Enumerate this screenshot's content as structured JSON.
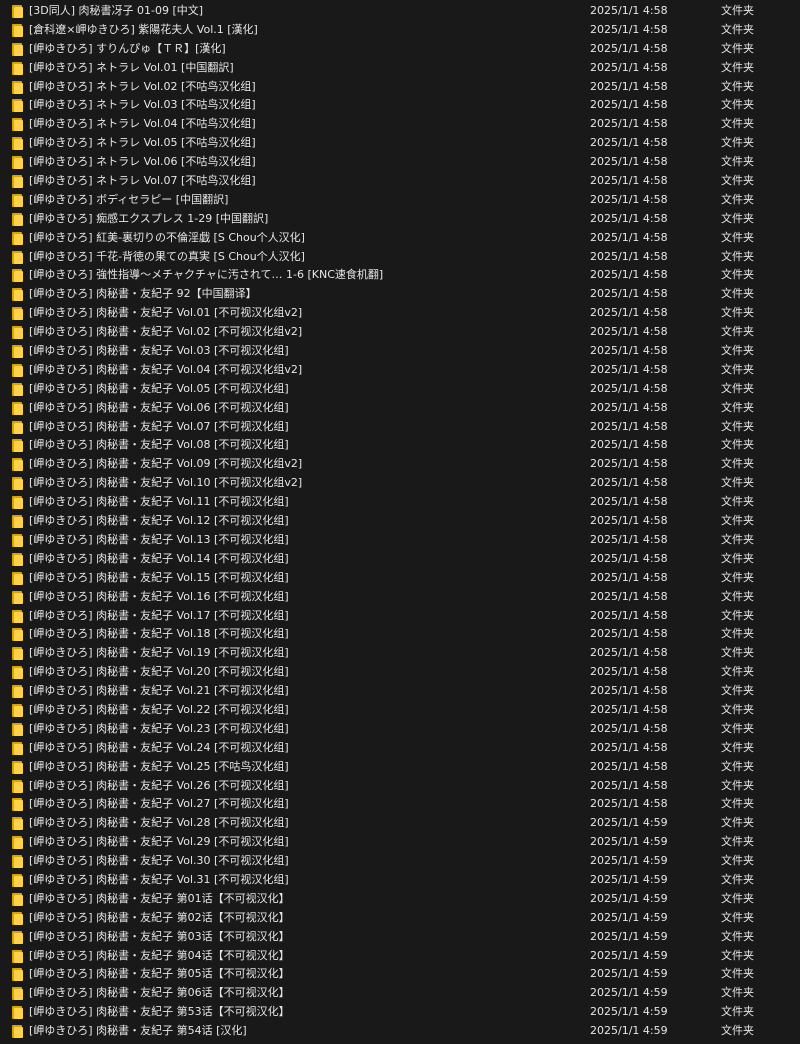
{
  "folder_icon": "folder-icon",
  "rows": [
    {
      "name": "[3D同人] 肉秘書冴子 01-09 [中文]",
      "date": "2025/1/1 4:58",
      "type": "文件夹"
    },
    {
      "name": "[倉科遼×岬ゆきひろ] 紫陽花夫人 Vol.1 [漢化]",
      "date": "2025/1/1 4:58",
      "type": "文件夹"
    },
    {
      "name": "[岬ゆきひろ] すりんぴゅ【ＴＲ】[漢化]",
      "date": "2025/1/1 4:58",
      "type": "文件夹"
    },
    {
      "name": "[岬ゆきひろ] ネトラレ Vol.01 [中国翻訳]",
      "date": "2025/1/1 4:58",
      "type": "文件夹"
    },
    {
      "name": "[岬ゆきひろ] ネトラレ Vol.02 [不咕鸟汉化组]",
      "date": "2025/1/1 4:58",
      "type": "文件夹"
    },
    {
      "name": "[岬ゆきひろ] ネトラレ Vol.03 [不咕鸟汉化组]",
      "date": "2025/1/1 4:58",
      "type": "文件夹"
    },
    {
      "name": "[岬ゆきひろ] ネトラレ Vol.04 [不咕鸟汉化组]",
      "date": "2025/1/1 4:58",
      "type": "文件夹"
    },
    {
      "name": "[岬ゆきひろ] ネトラレ Vol.05 [不咕鸟汉化组]",
      "date": "2025/1/1 4:58",
      "type": "文件夹"
    },
    {
      "name": "[岬ゆきひろ] ネトラレ Vol.06 [不咕鸟汉化组]",
      "date": "2025/1/1 4:58",
      "type": "文件夹"
    },
    {
      "name": "[岬ゆきひろ] ネトラレ Vol.07 [不咕鸟汉化组]",
      "date": "2025/1/1 4:58",
      "type": "文件夹"
    },
    {
      "name": "[岬ゆきひろ] ボディセラピー [中国翻訳]",
      "date": "2025/1/1 4:58",
      "type": "文件夹"
    },
    {
      "name": "[岬ゆきひろ] 痴感エクスプレス 1-29 [中国翻訳]",
      "date": "2025/1/1 4:58",
      "type": "文件夹"
    },
    {
      "name": "[岬ゆきひろ] 紅美-裏切りの不倫淫戯 [S Chou个人汉化]",
      "date": "2025/1/1 4:58",
      "type": "文件夹"
    },
    {
      "name": "[岬ゆきひろ] 千花-背徳の果ての真実 [S Chou个人汉化]",
      "date": "2025/1/1 4:58",
      "type": "文件夹"
    },
    {
      "name": "[岬ゆきひろ] 強性指導～メチャクチャに汚されて… 1-6 [KNC速食机翻]",
      "date": "2025/1/1 4:58",
      "type": "文件夹"
    },
    {
      "name": "[岬ゆきひろ] 肉秘書・友紀子 92【中国翻译】",
      "date": "2025/1/1 4:58",
      "type": "文件夹"
    },
    {
      "name": "[岬ゆきひろ] 肉秘書・友紀子 Vol.01 [不可视汉化组v2]",
      "date": "2025/1/1 4:58",
      "type": "文件夹"
    },
    {
      "name": "[岬ゆきひろ] 肉秘書・友紀子 Vol.02 [不可视汉化组v2]",
      "date": "2025/1/1 4:58",
      "type": "文件夹"
    },
    {
      "name": "[岬ゆきひろ] 肉秘書・友紀子 Vol.03 [不可视汉化组]",
      "date": "2025/1/1 4:58",
      "type": "文件夹"
    },
    {
      "name": "[岬ゆきひろ] 肉秘書・友紀子 Vol.04 [不可视汉化组v2]",
      "date": "2025/1/1 4:58",
      "type": "文件夹"
    },
    {
      "name": "[岬ゆきひろ] 肉秘書・友紀子 Vol.05 [不可视汉化组]",
      "date": "2025/1/1 4:58",
      "type": "文件夹"
    },
    {
      "name": "[岬ゆきひろ] 肉秘書・友紀子 Vol.06 [不可视汉化组]",
      "date": "2025/1/1 4:58",
      "type": "文件夹"
    },
    {
      "name": "[岬ゆきひろ] 肉秘書・友紀子 Vol.07 [不可视汉化组]",
      "date": "2025/1/1 4:58",
      "type": "文件夹"
    },
    {
      "name": "[岬ゆきひろ] 肉秘書・友紀子 Vol.08 [不可视汉化组]",
      "date": "2025/1/1 4:58",
      "type": "文件夹"
    },
    {
      "name": "[岬ゆきひろ] 肉秘書・友紀子 Vol.09 [不可视汉化组v2]",
      "date": "2025/1/1 4:58",
      "type": "文件夹"
    },
    {
      "name": "[岬ゆきひろ] 肉秘書・友紀子 Vol.10 [不可视汉化组v2]",
      "date": "2025/1/1 4:58",
      "type": "文件夹"
    },
    {
      "name": "[岬ゆきひろ] 肉秘書・友紀子 Vol.11 [不可视汉化组]",
      "date": "2025/1/1 4:58",
      "type": "文件夹"
    },
    {
      "name": "[岬ゆきひろ] 肉秘書・友紀子 Vol.12 [不可视汉化组]",
      "date": "2025/1/1 4:58",
      "type": "文件夹"
    },
    {
      "name": "[岬ゆきひろ] 肉秘書・友紀子 Vol.13 [不可视汉化组]",
      "date": "2025/1/1 4:58",
      "type": "文件夹"
    },
    {
      "name": "[岬ゆきひろ] 肉秘書・友紀子 Vol.14 [不可视汉化组]",
      "date": "2025/1/1 4:58",
      "type": "文件夹"
    },
    {
      "name": "[岬ゆきひろ] 肉秘書・友紀子 Vol.15 [不可视汉化组]",
      "date": "2025/1/1 4:58",
      "type": "文件夹"
    },
    {
      "name": "[岬ゆきひろ] 肉秘書・友紀子 Vol.16 [不可视汉化组]",
      "date": "2025/1/1 4:58",
      "type": "文件夹"
    },
    {
      "name": "[岬ゆきひろ] 肉秘書・友紀子 Vol.17 [不可视汉化组]",
      "date": "2025/1/1 4:58",
      "type": "文件夹"
    },
    {
      "name": "[岬ゆきひろ] 肉秘書・友紀子 Vol.18 [不可视汉化组]",
      "date": "2025/1/1 4:58",
      "type": "文件夹"
    },
    {
      "name": "[岬ゆきひろ] 肉秘書・友紀子 Vol.19 [不可视汉化组]",
      "date": "2025/1/1 4:58",
      "type": "文件夹"
    },
    {
      "name": "[岬ゆきひろ] 肉秘書・友紀子 Vol.20 [不可视汉化组]",
      "date": "2025/1/1 4:58",
      "type": "文件夹"
    },
    {
      "name": "[岬ゆきひろ] 肉秘書・友紀子 Vol.21 [不可视汉化组]",
      "date": "2025/1/1 4:58",
      "type": "文件夹"
    },
    {
      "name": "[岬ゆきひろ] 肉秘書・友紀子 Vol.22 [不可视汉化组]",
      "date": "2025/1/1 4:58",
      "type": "文件夹"
    },
    {
      "name": "[岬ゆきひろ] 肉秘書・友紀子 Vol.23 [不可视汉化组]",
      "date": "2025/1/1 4:58",
      "type": "文件夹"
    },
    {
      "name": "[岬ゆきひろ] 肉秘書・友紀子 Vol.24 [不可视汉化组]",
      "date": "2025/1/1 4:58",
      "type": "文件夹"
    },
    {
      "name": "[岬ゆきひろ] 肉秘書・友紀子 Vol.25 [不咕鸟汉化组]",
      "date": "2025/1/1 4:58",
      "type": "文件夹"
    },
    {
      "name": "[岬ゆきひろ] 肉秘書・友紀子 Vol.26 [不可视汉化组]",
      "date": "2025/1/1 4:58",
      "type": "文件夹"
    },
    {
      "name": "[岬ゆきひろ] 肉秘書・友紀子 Vol.27 [不可视汉化组]",
      "date": "2025/1/1 4:58",
      "type": "文件夹"
    },
    {
      "name": "[岬ゆきひろ] 肉秘書・友紀子 Vol.28 [不可视汉化组]",
      "date": "2025/1/1 4:59",
      "type": "文件夹"
    },
    {
      "name": "[岬ゆきひろ] 肉秘書・友紀子 Vol.29 [不可视汉化组]",
      "date": "2025/1/1 4:59",
      "type": "文件夹"
    },
    {
      "name": "[岬ゆきひろ] 肉秘書・友紀子 Vol.30 [不可视汉化组]",
      "date": "2025/1/1 4:59",
      "type": "文件夹"
    },
    {
      "name": "[岬ゆきひろ] 肉秘書・友紀子 Vol.31 [不可视汉化组]",
      "date": "2025/1/1 4:59",
      "type": "文件夹"
    },
    {
      "name": "[岬ゆきひろ] 肉秘書・友紀子 第01话【不可视汉化】",
      "date": "2025/1/1 4:59",
      "type": "文件夹"
    },
    {
      "name": "[岬ゆきひろ] 肉秘書・友紀子 第02话【不可视汉化】",
      "date": "2025/1/1 4:59",
      "type": "文件夹"
    },
    {
      "name": "[岬ゆきひろ] 肉秘書・友紀子 第03话【不可视汉化】",
      "date": "2025/1/1 4:59",
      "type": "文件夹"
    },
    {
      "name": "[岬ゆきひろ] 肉秘書・友紀子 第04话【不可视汉化】",
      "date": "2025/1/1 4:59",
      "type": "文件夹"
    },
    {
      "name": "[岬ゆきひろ] 肉秘書・友紀子 第05话【不可视汉化】",
      "date": "2025/1/1 4:59",
      "type": "文件夹"
    },
    {
      "name": "[岬ゆきひろ] 肉秘書・友紀子 第06话【不可视汉化】",
      "date": "2025/1/1 4:59",
      "type": "文件夹"
    },
    {
      "name": "[岬ゆきひろ] 肉秘書・友紀子 第53话【不可视汉化】",
      "date": "2025/1/1 4:59",
      "type": "文件夹"
    },
    {
      "name": "[岬ゆきひろ] 肉秘書・友紀子 第54话 [汉化]",
      "date": "2025/1/1 4:59",
      "type": "文件夹"
    }
  ]
}
